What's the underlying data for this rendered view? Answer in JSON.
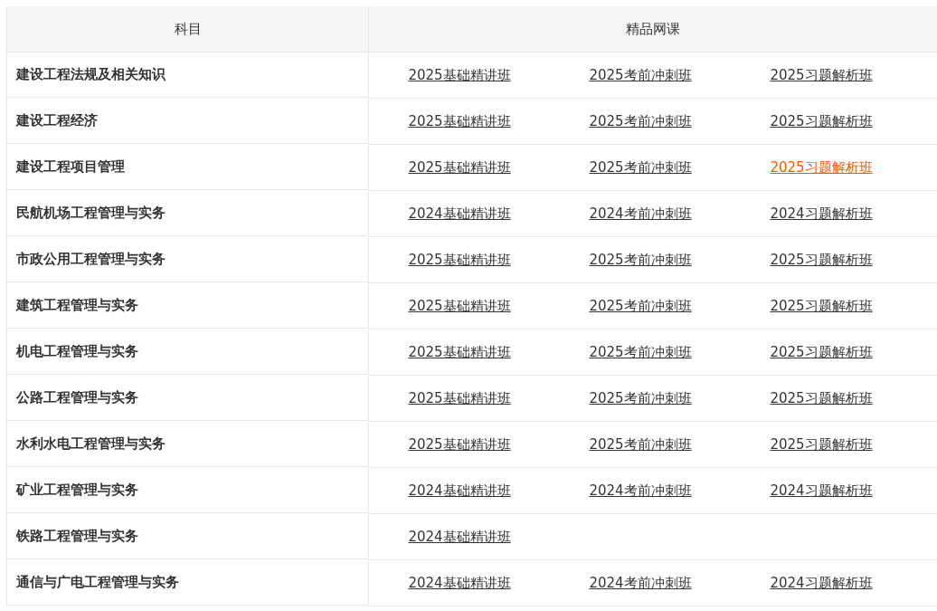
{
  "table": {
    "columns": [
      "科目",
      "精品网课"
    ],
    "rows": [
      {
        "subject": "建设工程法规及相关知识",
        "courses": [
          {
            "label": "2025基础精讲班",
            "active": false
          },
          {
            "label": "2025考前冲刺班",
            "active": false
          },
          {
            "label": "2025习题解析班",
            "active": false
          }
        ]
      },
      {
        "subject": "建设工程经济",
        "courses": [
          {
            "label": "2025基础精讲班",
            "active": false
          },
          {
            "label": "2025考前冲刺班",
            "active": false
          },
          {
            "label": "2025习题解析班",
            "active": false
          }
        ]
      },
      {
        "subject": "建设工程项目管理",
        "courses": [
          {
            "label": "2025基础精讲班",
            "active": false
          },
          {
            "label": "2025考前冲刺班",
            "active": false
          },
          {
            "label": "2025习题解析班",
            "active": true
          }
        ]
      },
      {
        "subject": "民航机场工程管理与实务",
        "courses": [
          {
            "label": "2024基础精讲班",
            "active": false
          },
          {
            "label": "2024考前冲刺班",
            "active": false
          },
          {
            "label": "2024习题解析班",
            "active": false
          }
        ]
      },
      {
        "subject": "市政公用工程管理与实务",
        "courses": [
          {
            "label": "2025基础精讲班",
            "active": false
          },
          {
            "label": "2025考前冲刺班",
            "active": false
          },
          {
            "label": "2025习题解析班",
            "active": false
          }
        ]
      },
      {
        "subject": "建筑工程管理与实务",
        "courses": [
          {
            "label": "2025基础精讲班",
            "active": false
          },
          {
            "label": "2025考前冲刺班",
            "active": false
          },
          {
            "label": "2025习题解析班",
            "active": false
          }
        ]
      },
      {
        "subject": "机电工程管理与实务",
        "courses": [
          {
            "label": "2025基础精讲班",
            "active": false
          },
          {
            "label": "2025考前冲刺班",
            "active": false
          },
          {
            "label": "2025习题解析班",
            "active": false
          }
        ]
      },
      {
        "subject": "公路工程管理与实务",
        "courses": [
          {
            "label": "2025基础精讲班",
            "active": false
          },
          {
            "label": "2025考前冲刺班",
            "active": false
          },
          {
            "label": "2025习题解析班",
            "active": false
          }
        ]
      },
      {
        "subject": "水利水电工程管理与实务",
        "courses": [
          {
            "label": "2025基础精讲班",
            "active": false
          },
          {
            "label": "2025考前冲刺班",
            "active": false
          },
          {
            "label": "2025习题解析班",
            "active": false
          }
        ]
      },
      {
        "subject": "矿业工程管理与实务",
        "courses": [
          {
            "label": "2024基础精讲班",
            "active": false
          },
          {
            "label": "2024考前冲刺班",
            "active": false
          },
          {
            "label": "2024习题解析班",
            "active": false
          }
        ]
      },
      {
        "subject": "铁路工程管理与实务",
        "courses": [
          {
            "label": "2024基础精讲班",
            "active": false
          }
        ]
      },
      {
        "subject": "通信与广电工程管理与实务",
        "courses": [
          {
            "label": "2024基础精讲班",
            "active": false
          },
          {
            "label": "2024考前冲刺班",
            "active": false
          },
          {
            "label": "2024习题解析班",
            "active": false
          }
        ]
      }
    ]
  }
}
